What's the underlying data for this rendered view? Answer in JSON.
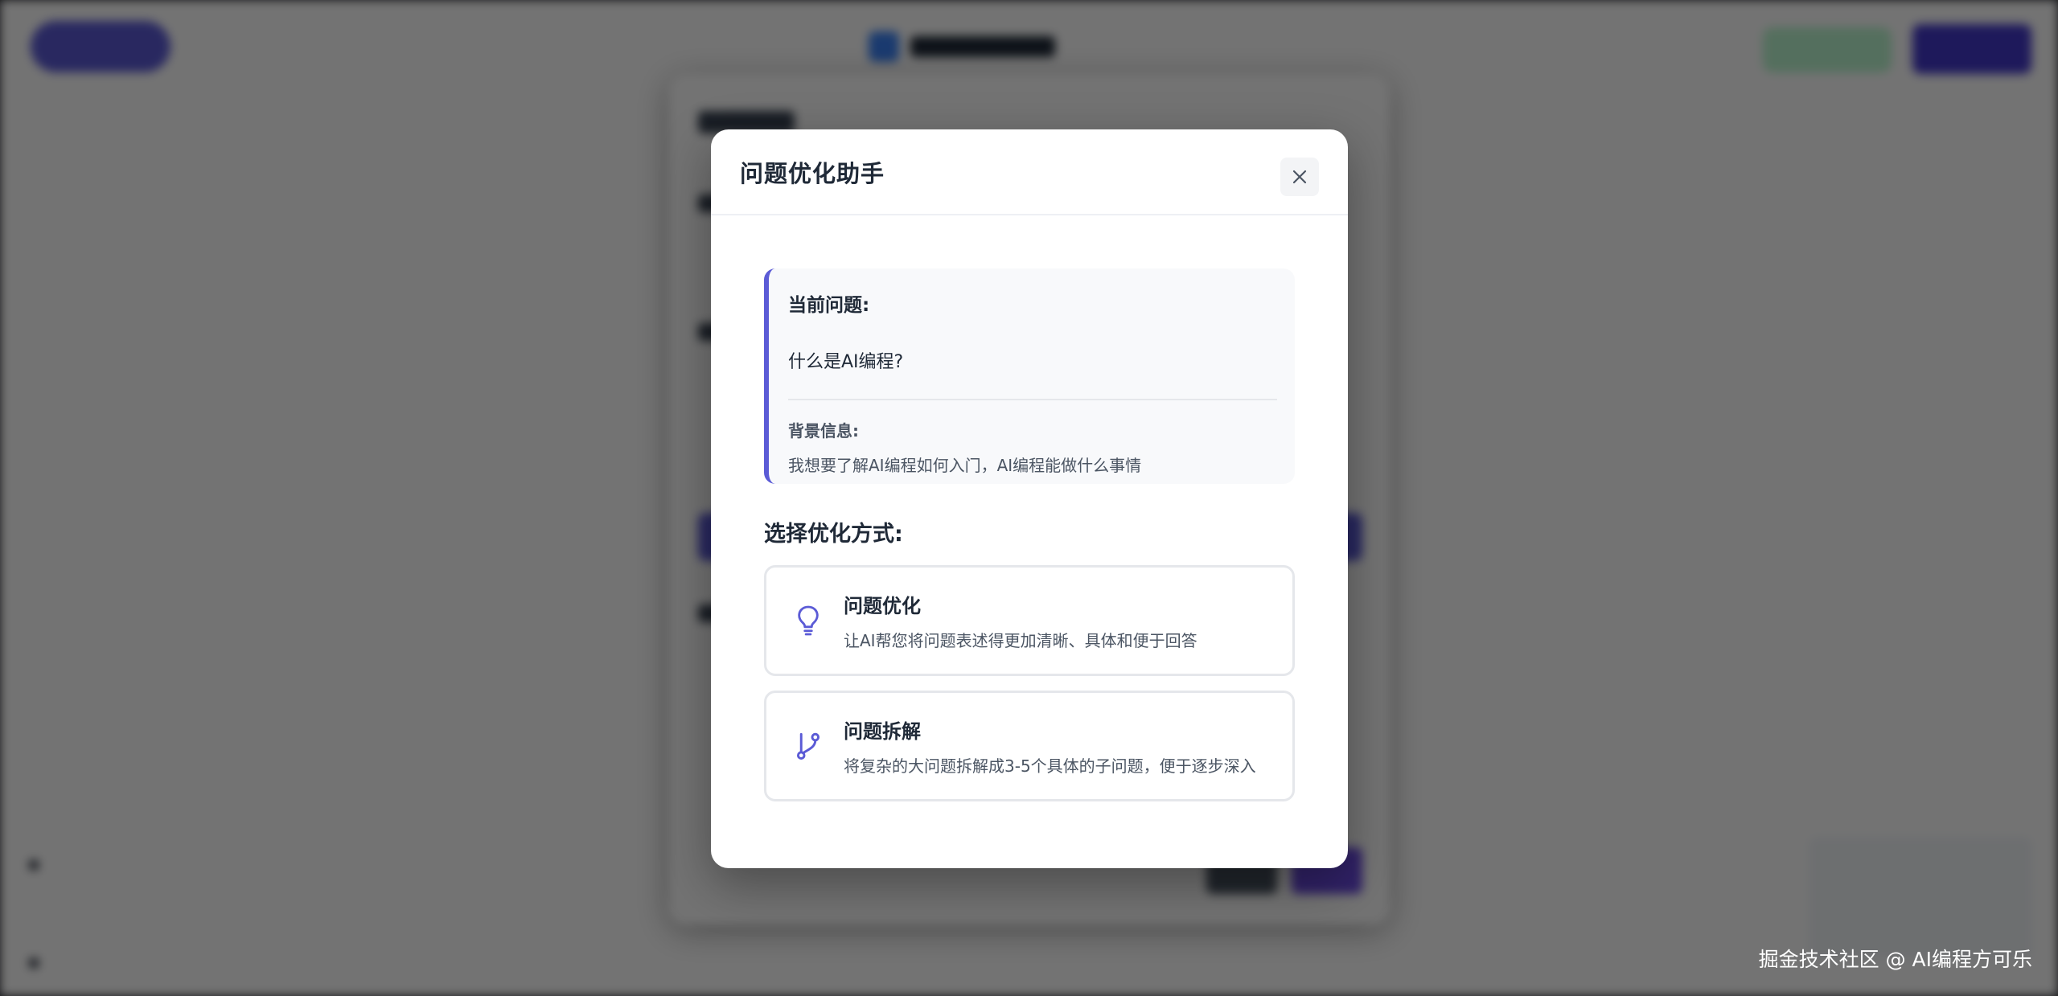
{
  "modal": {
    "title": "问题优化助手",
    "current_question_label": "当前问题:",
    "current_question": "什么是AI编程?",
    "background_label": "背景信息:",
    "background_text": "我想要了解AI编程如何入门，AI编程能做什么事情",
    "section_title": "选择优化方式:",
    "options": [
      {
        "icon": "lightbulb-icon",
        "title": "问题优化",
        "description": "让AI帮您将问题表述得更加清晰、具体和便于回答"
      },
      {
        "icon": "git-branch-icon",
        "title": "问题拆解",
        "description": "将复杂的大问题拆解成3-5个具体的子问题，便于逐步深入"
      }
    ]
  },
  "watermark": "掘金技术社区 @ AI编程方可乐",
  "colors": {
    "accent": "#5b5bd6",
    "overlay": "rgba(0,0,0,0.55)",
    "text_primary": "#1f2937",
    "text_secondary": "#4b5563"
  }
}
